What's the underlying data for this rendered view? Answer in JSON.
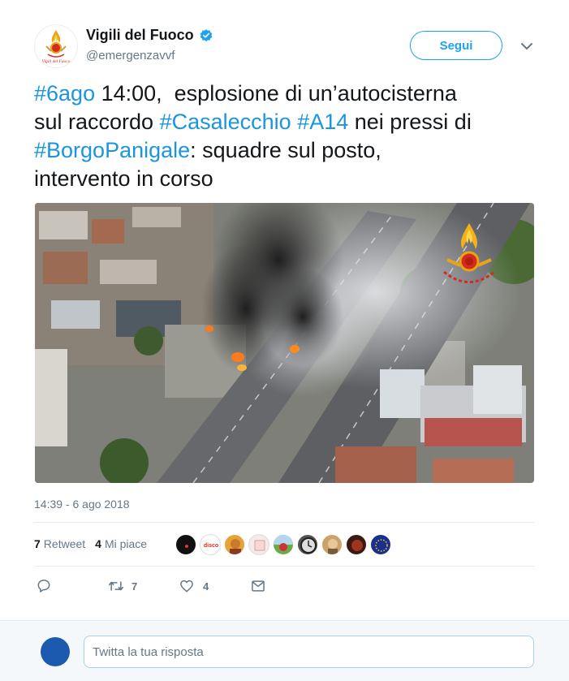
{
  "user": {
    "name": "Vigili del Fuoco",
    "handle": "@emergenzavvf",
    "verified": true,
    "avatar_icon": "fire-brigade-logo-icon",
    "avatar_text": "Vigili del Fuoco"
  },
  "follow_label": "Segui",
  "tweet": {
    "t1_tag": "#6ago",
    "t1_text": " 14:00,  esplosione di un’autocisterna",
    "t2_text": "sul raccordo ",
    "t2_tag1": "#Casalecchio",
    "t2_sep": " ",
    "t2_tag2": "#A14",
    "t2_text2": " nei pressi di",
    "t3_tag": "#BorgoPanigale",
    "t3_text": ": squadre sul posto,",
    "t4_text": "intervento in corso"
  },
  "photo_alt": "aerial-photo-highway-explosion",
  "timestamp": "14:39 - 6 ago 2018",
  "stats": {
    "retweet_count": "7",
    "retweet_label": "Retweet",
    "like_count": "4",
    "like_label": "Mi piace",
    "liker_badge_text": "disco"
  },
  "actions": {
    "reply_icon": "reply-icon",
    "retweet_icon": "retweet-icon",
    "retweet_count": "7",
    "like_icon": "heart-icon",
    "like_count": "4",
    "dm_icon": "envelope-icon"
  },
  "reply": {
    "placeholder": "Twitta la tua risposta"
  },
  "colors": {
    "accent": "#1da1f2",
    "hashtag": "#1b95e0",
    "muted": "#657786",
    "divider": "#e6ecf0"
  }
}
